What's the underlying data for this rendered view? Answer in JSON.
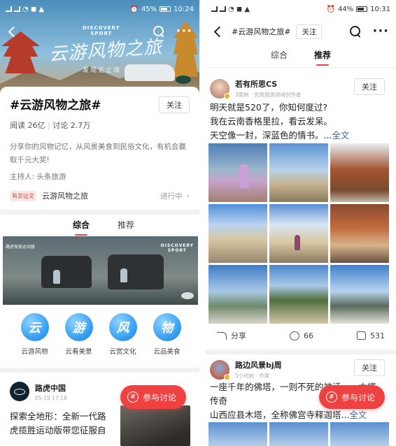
{
  "left": {
    "status": {
      "time": "10:24",
      "battery": "45%"
    },
    "hero": {
      "brand": "DISCOVERY\nSPORT",
      "calligraphy": "云游风物之旅",
      "slogan": "发现无止境"
    },
    "topic": {
      "title": "#云游风物之旅#",
      "follow_label": "关注",
      "reads": "阅读 26亿",
      "discussions": "讨论 2.7万",
      "description": "分享你的风物记忆，从风景美食到民俗文化，有机会赢取千元大奖!",
      "host": "主持人: 头条旅游"
    },
    "promo": {
      "tag": "有奖征文",
      "name": "云游风物之旅",
      "status": "进行中"
    },
    "tabs": [
      {
        "label": "综合",
        "active": true
      },
      {
        "label": "推荐",
        "active": false
      }
    ],
    "ad": {
      "caption": "路虎发现运动版",
      "brand": "DISCOVERY\nSPORT"
    },
    "icon_grid": [
      {
        "char": "云",
        "label": "云游风物"
      },
      {
        "char": "游",
        "label": "云看美景"
      },
      {
        "char": "风",
        "label": "云赏文化"
      },
      {
        "char": "物",
        "label": "云品美食"
      }
    ],
    "post": {
      "author": "路虎中国",
      "meta": "05-19 17:18",
      "text": "探索全地形：全新一代路虎揽胜运动版带您征服自"
    },
    "fab_label": "参与讨论",
    "fab_icon": "#"
  },
  "right": {
    "status": {
      "time": "10:31",
      "battery": "44%"
    },
    "nav": {
      "title": "#云游风物之旅#",
      "follow_label": "关注"
    },
    "tabs": [
      {
        "label": "综合",
        "active": false
      },
      {
        "label": "推荐",
        "active": true
      }
    ],
    "post1": {
      "author": "若有所思CS",
      "meta": "3周前 · 优质旅游领域创作者",
      "follow_label": "关注",
      "text_l1": "明天就是520了，你知何度过?",
      "text_l2": "我在云南香格里拉，看云发呆。",
      "text_l3": "天空像一封，深蓝色的情书。...",
      "more": "全文",
      "share_label": "分享",
      "comments": "66",
      "likes": "531"
    },
    "post2": {
      "author": "路边风景bj周",
      "meta": "5小时前 · 作家",
      "follow_label": "关注",
      "text_l1": "一座千年的佛塔，一则不死的神话——木塔",
      "text_l2": "传奇",
      "text_l3": "山西应县木塔，全称佛宫寺释迦塔...",
      "more": "全文"
    },
    "fab_label": "参与讨论",
    "fab_icon": "#"
  }
}
